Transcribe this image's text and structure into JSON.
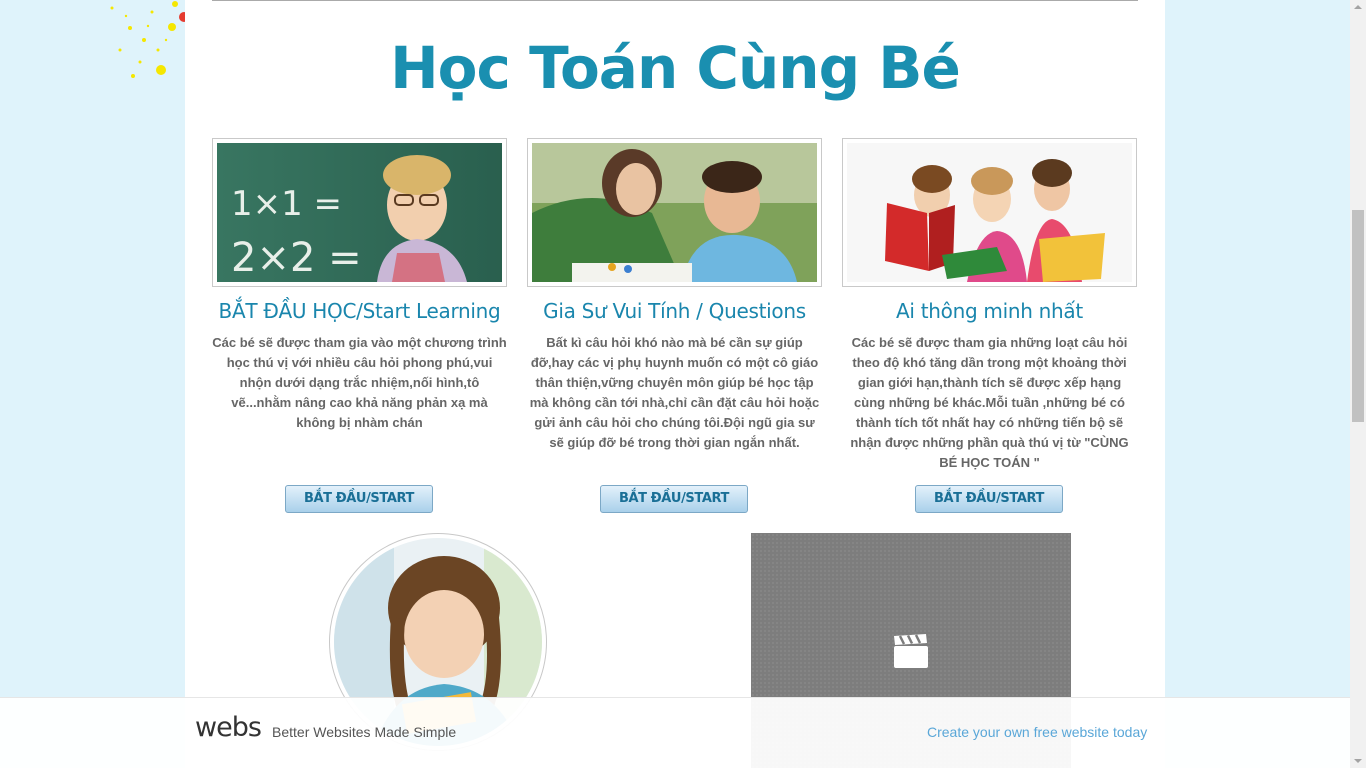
{
  "page": {
    "title": "Học Toán Cùng Bé"
  },
  "cards": [
    {
      "image": "boy-at-chalkboard-photo",
      "title": "BẮT ĐẦU HỌC/Start Learning",
      "text": "Các bé sẽ được tham gia vào một chương trình học thú vị với nhiều câu hỏi phong phú,vui nhộn dưới dạng trắc nhiệm,nối hình,tô vẽ...nhằm nâng cao khả năng phản xạ mà không bị nhàm chán",
      "button": "BẮT ĐẦU/START"
    },
    {
      "image": "tutor-with-boy-photo",
      "title": "Gia Sư Vui Tính / Questions",
      "text": "Bất kì câu hỏi khó nào mà bé cần sự giúp đỡ,hay các vị phụ huynh muốn có một cô giáo thân thiện,vững chuyên môn giúp bé học tập mà không cần tới nhà,chỉ cần đặt câu hỏi hoặc gửi ảnh câu hỏi cho chúng tôi.Đội ngũ gia sư sẽ giúp đỡ bé trong thời gian ngắn nhất.",
      "button": "BẮT ĐẦU/START"
    },
    {
      "image": "girls-reading-books-photo",
      "title": "Ai thông minh nhất",
      "text": "Các bé sẽ được tham gia những loạt câu hỏi theo độ khó tăng dần trong một khoảng thời gian giới hạn,thành tích sẽ được xếp hạng cùng những bé khác.Mỗi tuần ,những bé có thành tích tốt nhất hay có những tiến bộ sẽ nhận được những phần quà thú vị từ \"CÙNG BÉ HỌC TOÁN \"",
      "button": "BẮT ĐẦU/START"
    }
  ],
  "media": {
    "circle_image": "girl-studying-photo",
    "video_icon": "clapperboard-icon"
  },
  "footer": {
    "logo": "webs",
    "tagline": "Better Websites Made Simple",
    "cta": "Create your own free website today"
  },
  "colors": {
    "background": "#dff3fb",
    "accent": "#1a8fb0",
    "button_top": "#e3f1fb",
    "button_bottom": "#a9d0ea",
    "link": "#5aa7d8"
  }
}
